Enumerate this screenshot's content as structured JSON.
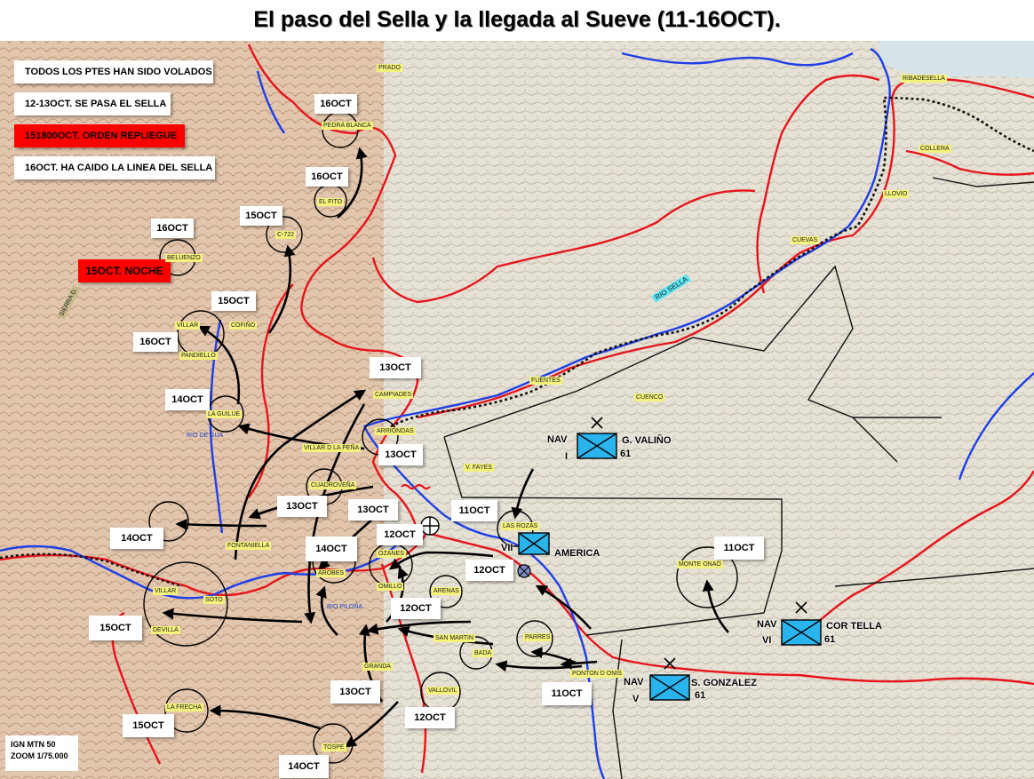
{
  "title": "El paso del Sella y la llegada al Sueve (11-16OCT).",
  "notes": {
    "n1": "TODOS LOS PTES HAN SIDO VOLADOS",
    "n2": "12-13OCT. SE PASA EL SELLA",
    "n3": "151800OCT. ORDEN REPLIEGUE",
    "n4": "16OCT. HA CAIDO LA LINEA DEL SELLA",
    "noche": "15OCT. NOCHE"
  },
  "dates": {
    "d16_pedra": "16OCT",
    "d16_fito": "16OCT",
    "d15_c722": "15OCT",
    "d16_beluenzo": "16OCT",
    "d15_cofino": "15OCT",
    "d16_villar": "16OCT",
    "d14_guilue": "14OCT",
    "d13_campiades": "13OCT",
    "d13_arriondas": "13OCT",
    "d13_cuadroveña": "13OCT",
    "d13_fontaniella": "13OCT",
    "d14_left": "14OCT",
    "d14_arobes": "14OCT",
    "d12_ozanes": "12OCT",
    "d11_rozas": "11OCT",
    "d12_america": "12OCT",
    "d15_villar": "15OCT",
    "d12_arenas": "12OCT",
    "d13_granda": "13OCT",
    "d12_vallovil": "12OCT",
    "d11_ponton": "11OCT",
    "d15_frecha": "15OCT",
    "d14_tospe": "14OCT",
    "d11_monte": "11OCT"
  },
  "places": {
    "prado": "PRADO",
    "ribadesella": "RIBADESELLA",
    "collera": "COLLERA",
    "llovio": "LLOVIO",
    "cuevas": "CUEVAS",
    "pedra_blanca": "PEDRA BLANCA",
    "el_fito": "EL FITO",
    "c722": "C-722",
    "beluenzo": "BELUENZO",
    "villar": "VILLAR",
    "cofino": "COFIÑO",
    "pandiello": "PANDIELLO",
    "campiades": "CAMPIADES",
    "fuentes": "FUENTES",
    "cuenco": "CUENCO",
    "la_guilue": "LA GUILUE",
    "arriondas": "ARRIONDAS",
    "villar_pena": "VILLAR D LA PEÑA",
    "v_fayes": "V. FAYES",
    "cuadroveña": "CUADROVEÑA",
    "las_rozas": "LAS ROZAS",
    "fontaniella": "FONTANIELLA",
    "ozanes": "OZANES",
    "arobes": "AROBES",
    "omillo": "OMILLO",
    "villar2": "VILLAR",
    "soto": "SOTO",
    "devilla": "DEVILLA",
    "arenas": "ARENAS",
    "monte_onao": "MONTE ONAO",
    "san_martin": "SAN MARTIN",
    "parres": "PARRES",
    "bada": "BADA",
    "granda": "GRANDA",
    "ponton": "PONTON D ONIS",
    "vallovil": "VALLOVIL",
    "la_frecha": "LA FRECHA",
    "tospe": "TOSPE",
    "sierra": "SIERRA D."
  },
  "rivers": {
    "sella": "RIO SELLA",
    "gua": "RIO DE GUA",
    "pilona": "RIO PILOÑA"
  },
  "units": {
    "valino": {
      "side": "NAV",
      "corps": "I",
      "name": "G. VALIÑO",
      "div": "61"
    },
    "america": {
      "side": "VII",
      "name": "AMERICA"
    },
    "tella": {
      "side": "NAV",
      "corps": "VI",
      "name": "COR TELLA",
      "div": "61"
    },
    "gonzalez": {
      "side": "NAV",
      "corps": "V",
      "name": "S. GONZALEZ",
      "div": "61"
    }
  },
  "legend": {
    "line1": "IGN MTN 50",
    "line2": "ZOOM 1/75.000"
  },
  "colors": {
    "road": "#e8141b",
    "river": "#1f3fe8",
    "arrow": "#000000",
    "unit": "#2ab4ee",
    "label_bg": "#f4f27a"
  }
}
